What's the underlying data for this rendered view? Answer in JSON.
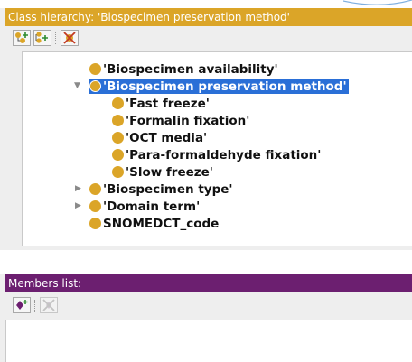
{
  "hierarchy": {
    "title": "Class hierarchy: 'Biospecimen preservation method'",
    "header_color": "#dba528",
    "toolbar": [
      {
        "icon": "add-subclass-icon"
      },
      {
        "icon": "add-sibling-class-icon"
      },
      {
        "icon": "delete-class-icon"
      }
    ],
    "items": [
      {
        "label": "'Biospecimen availability'",
        "expander": "none"
      },
      {
        "label": "'Biospecimen preservation method'",
        "expander": "expanded",
        "selected": true
      },
      {
        "label": "'Fast freeze'",
        "expander": "none"
      },
      {
        "label": "'Formalin fixation'",
        "expander": "none"
      },
      {
        "label": "'OCT media'",
        "expander": "none"
      },
      {
        "label": "'Para-formaldehyde fixation'",
        "expander": "none"
      },
      {
        "label": "'Slow freeze'",
        "expander": "none"
      },
      {
        "label": "'Biospecimen type'",
        "expander": "collapsed"
      },
      {
        "label": "'Domain term'",
        "expander": "collapsed"
      },
      {
        "label": "SNOMEDCT_code",
        "expander": "none"
      }
    ]
  },
  "members": {
    "title": "Members list:",
    "header_color": "#6c1f70",
    "toolbar": [
      {
        "icon": "add-individual-icon"
      },
      {
        "icon": "delete-individual-icon"
      }
    ]
  },
  "colors": {
    "class_dot": "#dba528",
    "selection": "#2a6fd7"
  }
}
